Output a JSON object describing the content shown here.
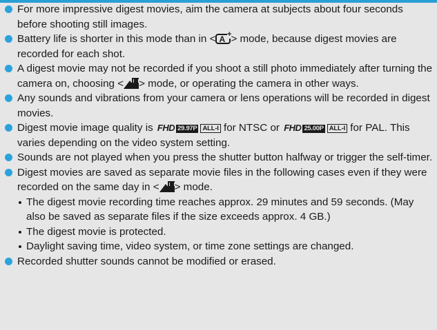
{
  "icons": {
    "scene_intelligent_auto": "A",
    "scene_intelligent_auto_plus": "+",
    "fhd": "FHD",
    "rate_ntsc": "29.97P",
    "rate_pal": "25.00P",
    "compression": "ALL-I"
  },
  "notes": [
    {
      "text": "For more impressive digest movies, aim the camera at subjects about four seconds before shooting still images."
    },
    {
      "pre": "Battery life is shorter in this mode than in <",
      "post": "> mode, because digest movies are recorded for each shot."
    },
    {
      "pre": "A digest movie may not be recorded if you shoot a still photo immediately after turning the camera on, choosing <",
      "post": "> mode, or operating the camera in other ways."
    },
    {
      "text": "Any sounds and vibrations from your camera or lens operations will be recorded in digest movies."
    },
    {
      "pre": "Digest movie image quality is",
      "mid": "for NTSC or",
      "post": "for PAL. This varies depending on the video system setting."
    },
    {
      "text": "Sounds are not played when you press the shutter button halfway or trigger the self-timer."
    },
    {
      "pre": "Digest movies are saved as separate movie files in the following cases even if they were recorded on the same day in <",
      "post": "> mode.",
      "sub": [
        "The digest movie recording time reaches approx. 29 minutes and 59 seconds. (May also be saved as separate files if the size exceeds approx. 4 GB.)",
        "The digest movie is protected.",
        "Daylight saving time, video system, or time zone settings are changed."
      ]
    },
    {
      "text": "Recorded shutter sounds cannot be modified or erased."
    }
  ]
}
